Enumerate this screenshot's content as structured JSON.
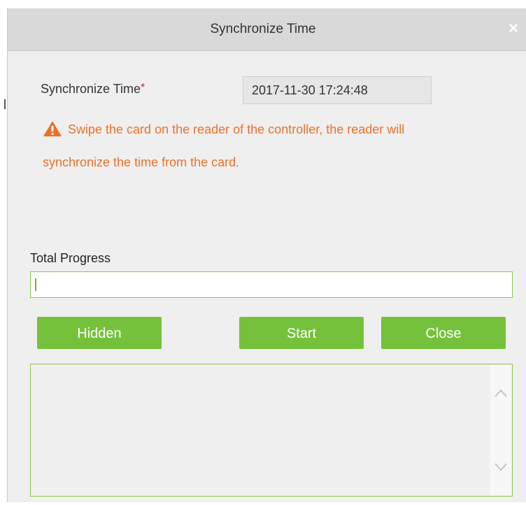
{
  "dialog": {
    "title": "Synchronize Time",
    "close_glyph": "×"
  },
  "form": {
    "time_label": "Synchronize Time",
    "required_mark": "*",
    "time_value": "2017-11-30 17:24:48"
  },
  "warning": {
    "icon": "warning-triangle-icon",
    "line1": "Swipe the card on the reader of the controller, the reader will",
    "line2": "synchronize the time from the card.",
    "color": "#e9722a"
  },
  "progress": {
    "label": "Total Progress",
    "percent": 0
  },
  "buttons": {
    "hidden": "Hidden",
    "start": "Start",
    "close": "Close"
  },
  "log": {
    "content": ""
  },
  "colors": {
    "accent_green": "#76c13b",
    "border_green": "#8cc84b",
    "required_red": "#e02020"
  }
}
